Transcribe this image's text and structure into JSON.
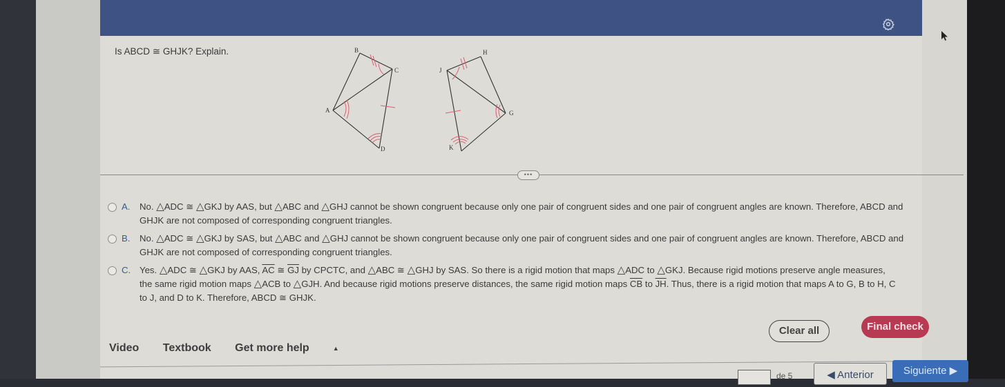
{
  "header": {
    "settings_icon": "gear-icon"
  },
  "question": {
    "text": "Is ABCD ≅ GHJK? Explain."
  },
  "figure": {
    "left_quadrilateral": {
      "labels": [
        "A",
        "B",
        "C",
        "D"
      ]
    },
    "right_quadrilateral": {
      "labels": [
        "G",
        "H",
        "J",
        "K"
      ]
    }
  },
  "expand_toggle": {
    "label": "•••"
  },
  "options": [
    {
      "letter": "A.",
      "line1_parts": [
        "No. ",
        "△",
        "ADC ≅ ",
        "△",
        "GKJ by AAS, but ",
        "△",
        "ABC and ",
        "△",
        "GHJ cannot be shown congruent because only one pair of congruent sides and one pair of congruent angles are known. Therefore, ABCD and"
      ],
      "line2": "GHJK are not composed of corresponding congruent triangles."
    },
    {
      "letter": "B.",
      "line1_parts": [
        "No. ",
        "△",
        "ADC ≅ ",
        "△",
        "GKJ by SAS, but ",
        "△",
        "ABC and ",
        "△",
        "GHJ cannot be shown congruent because only one pair of congruent sides and one pair of congruent angles are known. Therefore, ABCD and"
      ],
      "line2": "GHJK are not composed of corresponding congruent triangles."
    },
    {
      "letter": "C.",
      "p1": "Yes. ",
      "p2": "ADC ≅ ",
      "p3": "GKJ by AAS, ",
      "seg1": "AC",
      "p4": " ≅ ",
      "seg2": "GJ",
      "p5": " by CPCTC, and ",
      "p6": "ABC ≅ ",
      "p7": "GHJ by SAS. So there is a rigid motion that maps ",
      "p8": "ADC to ",
      "p9": "GKJ. Because rigid motions preserve angle measures,",
      "p10": "the same rigid motion maps ",
      "p11": "ACB to ",
      "p12": "GJH. And because rigid motions preserve distances, the same rigid motion maps ",
      "seg3": "CB",
      "p13": " to ",
      "seg4": "JH",
      "p14": ". Thus, there is a rigid motion that maps A to G, B to H, C",
      "p15": "to J, and D to K. Therefore, ABCD ≅ GHJK."
    }
  ],
  "help": {
    "video": "Video",
    "textbook": "Textbook",
    "more_help": "Get more help",
    "more_help_arrow": "▲"
  },
  "buttons": {
    "clear_all": "Clear all",
    "final_check": "Final check"
  },
  "pagination": {
    "current_page": "",
    "of_label": "de 5",
    "previous": "◀ Anterior",
    "next": "Siguiente ▶"
  },
  "colors": {
    "header": "#3e5283",
    "final_check": "#b83a52",
    "next": "#3a6db8",
    "marks": "#d9606f"
  }
}
